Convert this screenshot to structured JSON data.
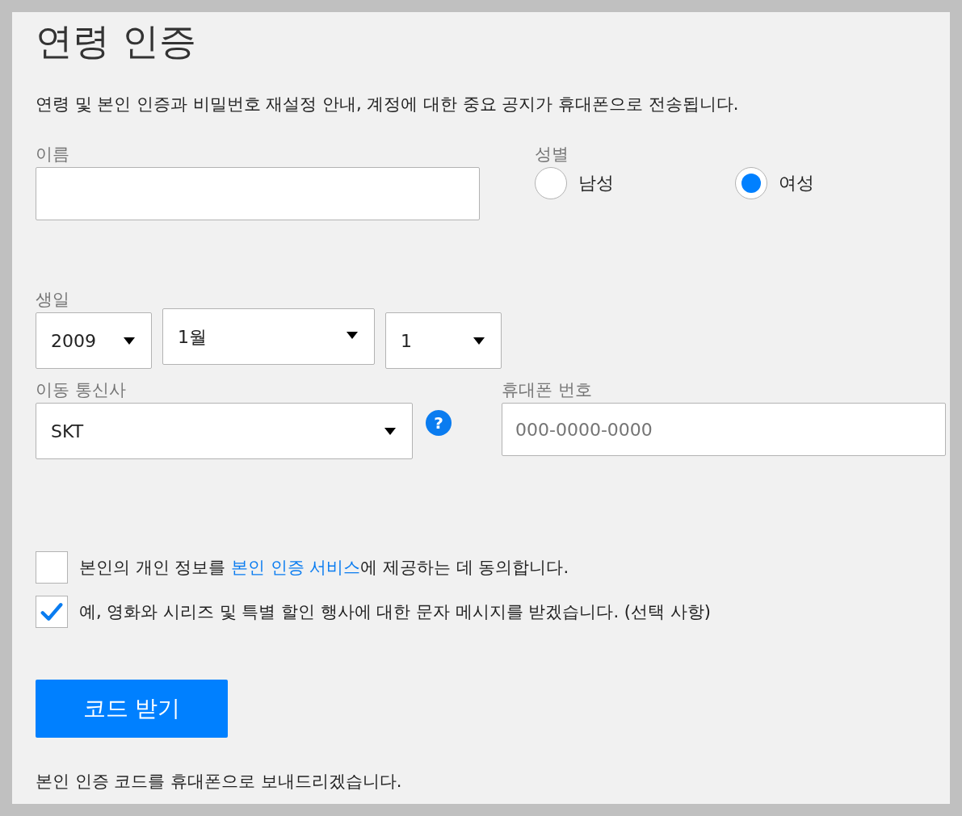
{
  "title": "연령 인증",
  "description": "연령 및 본인 인증과 비밀번호 재설정 안내, 계정에 대한 중요 공지가 휴대폰으로 전송됩니다.",
  "name_field": {
    "label": "이름"
  },
  "gender": {
    "label": "성별",
    "options": [
      {
        "label": "남성",
        "selected": false
      },
      {
        "label": "여성",
        "selected": true
      }
    ]
  },
  "birthday": {
    "label": "생일",
    "year": "2009",
    "month": "1월",
    "day": "1"
  },
  "carrier": {
    "label": "이동 통신사",
    "value": "SKT",
    "help": "?"
  },
  "phone": {
    "label": "휴대폰 번호",
    "placeholder": "000-0000-0000"
  },
  "consents": [
    {
      "text_before": "본인의 개인 정보를 ",
      "link": "본인 인증 서비스",
      "text_after": "에 제공하는 데 동의합니다.",
      "checked": false
    },
    {
      "text_before": "예, 영화와 시리즈 및 특별 할인 행사에 대한 문자 메시지를 받겠습니다. (선택 사항)",
      "checked": true
    }
  ],
  "submit_button": "코드 받기",
  "footer_note": "본인 인증 코드를 휴대폰으로 보내드리겠습니다."
}
